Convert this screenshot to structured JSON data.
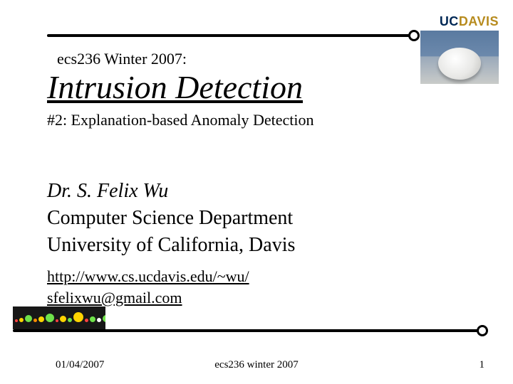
{
  "logo": {
    "uc": "UC",
    "davis": "DAVIS"
  },
  "course": "ecs236 Winter 2007:",
  "title": "Intrusion Detection",
  "subtitle": "#2: Explanation-based Anomaly Detection",
  "affil": {
    "name": "Dr. S. Felix Wu",
    "dept": "Computer Science Department",
    "univ": "University of California, Davis"
  },
  "links": {
    "url": "http://www.cs.ucdavis.edu/~wu/",
    "email": "sfelixwu@gmail.com"
  },
  "footer": {
    "date": "01/04/2007",
    "center": "ecs236 winter 2007",
    "page": "1"
  }
}
